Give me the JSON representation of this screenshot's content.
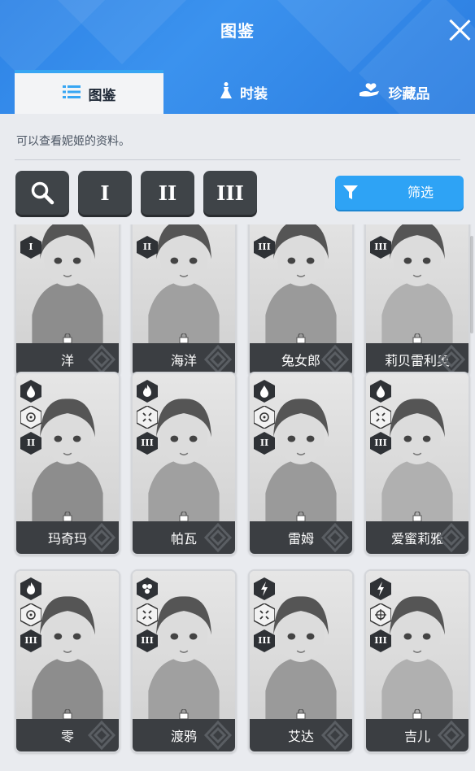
{
  "window": {
    "title": "图鉴"
  },
  "tabs": [
    {
      "label": "图鉴",
      "icon": "list-icon",
      "active": true
    },
    {
      "label": "时装",
      "icon": "dress-icon",
      "active": false
    },
    {
      "label": "珍藏品",
      "icon": "heart-hand-icon",
      "active": false
    }
  ],
  "description": "可以查看妮姬的资料。",
  "toolbar": {
    "search_icon": "search-icon",
    "burst_filters": [
      "I",
      "II",
      "III"
    ],
    "filter_label": "筛选",
    "filter_icon": "funnel-icon"
  },
  "cards": [
    {
      "name": "洋",
      "burst": "I",
      "weapon": "",
      "element": ""
    },
    {
      "name": "海洋",
      "burst": "II",
      "weapon": "",
      "element": ""
    },
    {
      "name": "兔女郎",
      "burst": "III",
      "weapon": "",
      "element": ""
    },
    {
      "name": "莉贝雷利奥",
      "burst": "III",
      "weapon": "",
      "element": ""
    },
    {
      "name": "玛奇玛",
      "burst": "II",
      "weapon": "circle",
      "element": "water"
    },
    {
      "name": "帕瓦",
      "burst": "III",
      "weapon": "cross",
      "element": "fire"
    },
    {
      "name": "雷姆",
      "burst": "II",
      "weapon": "circle",
      "element": "water"
    },
    {
      "name": "爱蜜莉雅",
      "burst": "III",
      "weapon": "cross",
      "element": "water"
    },
    {
      "name": "零",
      "burst": "III",
      "weapon": "circle",
      "element": "fire"
    },
    {
      "name": "渡鸦",
      "burst": "III",
      "weapon": "cross",
      "element": "iron"
    },
    {
      "name": "艾达",
      "burst": "III",
      "weapon": "cross",
      "element": "electric"
    },
    {
      "name": "吉儿",
      "burst": "III",
      "weapon": "target",
      "element": "electric"
    }
  ],
  "colors": {
    "header": "#2d83e6",
    "accent": "#2ea3f5",
    "dark_button": "#3f4448",
    "card_bar": "#3b3e42"
  }
}
